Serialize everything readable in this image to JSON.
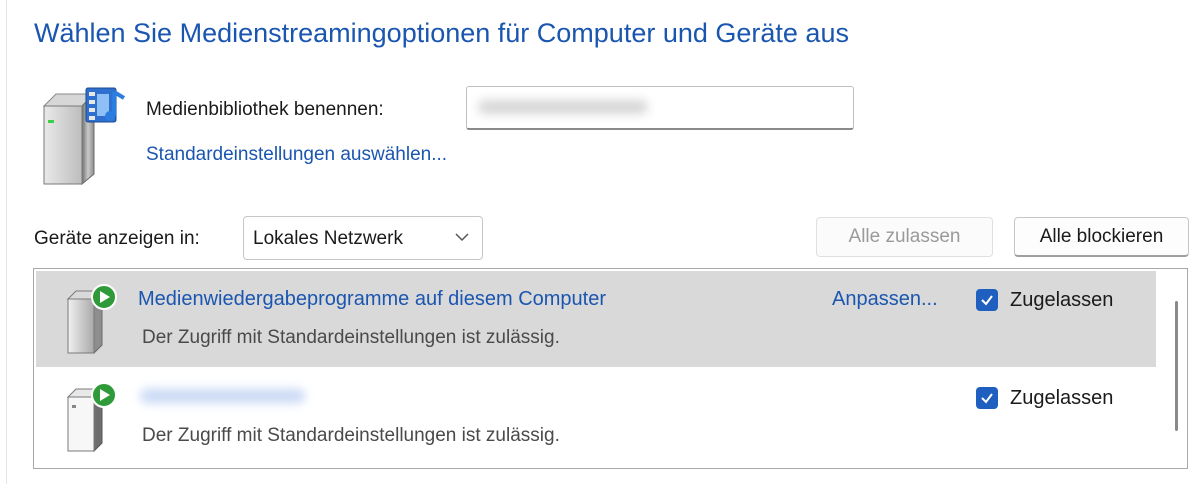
{
  "header": {
    "title": "Wählen Sie Medienstreamingoptionen für Computer und Geräte aus"
  },
  "library": {
    "name_label": "Medienbibliothek benennen:",
    "name_value": "",
    "defaults_link": "Standardeinstellungen auswählen..."
  },
  "filter": {
    "label": "Geräte anzeigen in:",
    "selected": "Lokales Netzwerk"
  },
  "actions": {
    "allow_all": "Alle zulassen",
    "block_all": "Alle blockieren"
  },
  "devices": [
    {
      "name": "Medienwiedergabeprogramme auf diesem Computer",
      "description": "Der Zugriff mit Standardeinstellungen ist zulässig.",
      "customize": "Anpassen...",
      "status": "Zugelassen",
      "allowed": true
    },
    {
      "name": "",
      "description": "Der Zugriff mit Standardeinstellungen ist zulässig.",
      "status": "Zugelassen",
      "allowed": true
    }
  ],
  "colors": {
    "link": "#1a56b0",
    "accent": "#1f5fbf",
    "selected_row": "#d9d9d9"
  }
}
